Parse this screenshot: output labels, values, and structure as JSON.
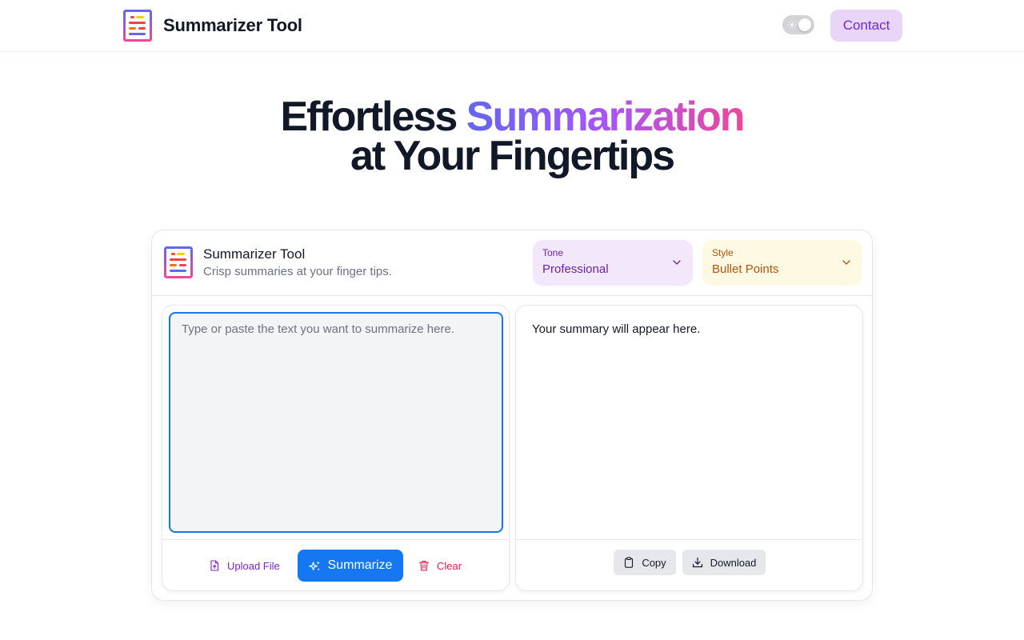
{
  "nav": {
    "brand_title": "Summarizer Tool",
    "contact_label": "Contact",
    "theme_toggle_state": "light"
  },
  "hero": {
    "line1_plain": "Effortless ",
    "line1_highlight": "Summarization",
    "line2": "at Your Fingertips"
  },
  "card": {
    "title": "Summarizer Tool",
    "subtitle": "Crisp summaries at your finger tips.",
    "tone": {
      "label": "Tone",
      "value": "Professional"
    },
    "style": {
      "label": "Style",
      "value": "Bullet Points"
    }
  },
  "input": {
    "placeholder": "Type or paste the text you want to summarize here.",
    "value": "",
    "upload_label": "Upload File",
    "summarize_label": "Summarize",
    "clear_label": "Clear"
  },
  "output": {
    "placeholder_text": "Your summary will appear here.",
    "copy_label": "Copy",
    "download_label": "Download"
  },
  "colors": {
    "primary": "#1677f2",
    "accent_purple": "#6d28d9",
    "contact_bg": "#e9d5f7",
    "tone_bg": "#f3e8fb",
    "style_bg": "#fef9e3",
    "clear_red": "#e11d48",
    "hero_gradient": [
      "#6366f1",
      "#a855f7",
      "#ec4899"
    ]
  },
  "icons": {
    "brand": "document-lines-logo",
    "theme": "sun-icon",
    "chevron": "chevron-down-icon",
    "upload": "file-upload-icon",
    "summarize": "sparkles-icon",
    "clear": "trash-icon",
    "copy": "clipboard-icon",
    "download": "download-icon"
  }
}
